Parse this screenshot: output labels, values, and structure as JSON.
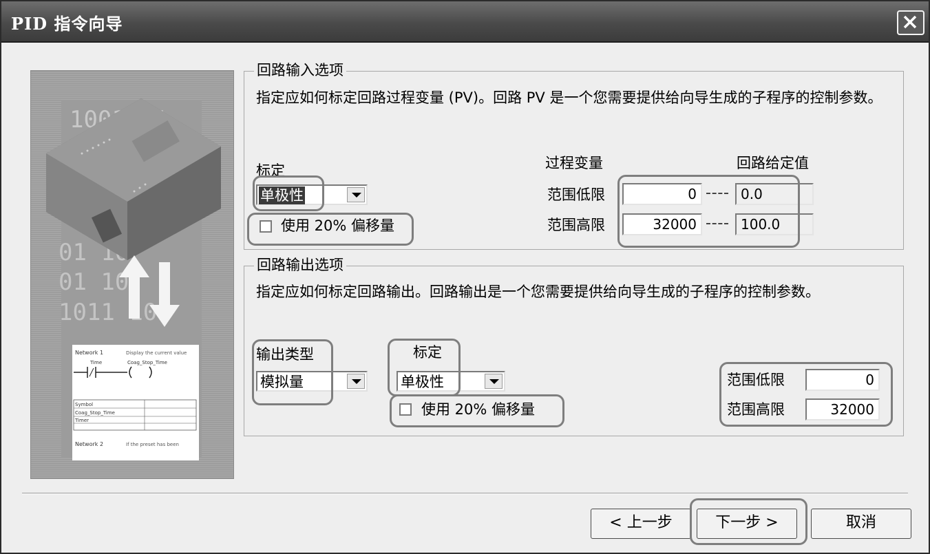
{
  "window": {
    "title": "PID 指令向导"
  },
  "input_group": {
    "title": "回路输入选项",
    "description": "指定应如何标定回路过程变量 (PV)。回路 PV 是一个您需要提供给向导生成的子程序的控制参数。",
    "scaling_label": "标定",
    "scaling_value": "单极性",
    "offset_checkbox": "使用 20% 偏移量",
    "pv_header": "过程变量",
    "setpoint_header": "回路给定值",
    "low_label": "范围低限",
    "high_label": "范围高限",
    "pv_low": "0",
    "pv_high": "32000",
    "sp_low": "0.0",
    "sp_high": "100.0"
  },
  "output_group": {
    "title": "回路输出选项",
    "description": "指定应如何标定回路输出。回路输出是一个您需要提供给向导生成的子程序的控制参数。",
    "type_label": "输出类型",
    "type_value": "模拟量",
    "scaling_label": "标定",
    "scaling_value": "单极性",
    "offset_checkbox": "使用 20% 偏移量",
    "low_label": "范围低限",
    "high_label": "范围高限",
    "low_value": "0",
    "high_value": "32000"
  },
  "buttons": {
    "prev": "< 上一步",
    "next": "下一步 >",
    "cancel": "取消"
  },
  "illustration": {
    "digits_top": "1001 01",
    "network1_label": "Network 1",
    "network2_label": "Network 2",
    "contact_tag": "Time",
    "coil_tag": "Coag_Stop_Time",
    "table_rows": [
      "Symbol",
      "Coag_Stop_Time",
      "Timer"
    ]
  }
}
